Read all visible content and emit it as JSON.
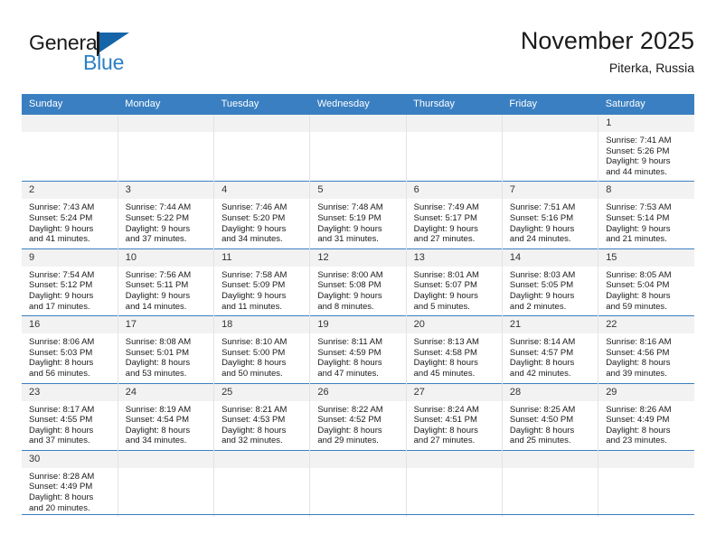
{
  "brand": {
    "name_top": "General",
    "name_bottom": "Blue",
    "color_dark": "#1a1a1a",
    "color_blue": "#2b7fc4",
    "flag_icon": "blue-flag-triangle"
  },
  "header": {
    "title": "November 2025",
    "subtitle": "Piterka, Russia"
  },
  "theme": {
    "header_bg": "#3a7fc1",
    "header_text": "#ffffff",
    "daynum_band_bg": "#f2f2f2",
    "row_divider": "#3a7fc1",
    "column_divider": "#e3e3e3"
  },
  "weekday_headers": [
    "Sunday",
    "Monday",
    "Tuesday",
    "Wednesday",
    "Thursday",
    "Friday",
    "Saturday"
  ],
  "weeks": [
    [
      {
        "blank": true,
        "day": ""
      },
      {
        "blank": true,
        "day": ""
      },
      {
        "blank": true,
        "day": ""
      },
      {
        "blank": true,
        "day": ""
      },
      {
        "blank": true,
        "day": ""
      },
      {
        "blank": true,
        "day": ""
      },
      {
        "blank": false,
        "day": "1",
        "sunrise": "Sunrise: 7:41 AM",
        "sunset": "Sunset: 5:26 PM",
        "daylight_line1": "Daylight: 9 hours",
        "daylight_line2": "and 44 minutes."
      }
    ],
    [
      {
        "blank": false,
        "day": "2",
        "sunrise": "Sunrise: 7:43 AM",
        "sunset": "Sunset: 5:24 PM",
        "daylight_line1": "Daylight: 9 hours",
        "daylight_line2": "and 41 minutes."
      },
      {
        "blank": false,
        "day": "3",
        "sunrise": "Sunrise: 7:44 AM",
        "sunset": "Sunset: 5:22 PM",
        "daylight_line1": "Daylight: 9 hours",
        "daylight_line2": "and 37 minutes."
      },
      {
        "blank": false,
        "day": "4",
        "sunrise": "Sunrise: 7:46 AM",
        "sunset": "Sunset: 5:20 PM",
        "daylight_line1": "Daylight: 9 hours",
        "daylight_line2": "and 34 minutes."
      },
      {
        "blank": false,
        "day": "5",
        "sunrise": "Sunrise: 7:48 AM",
        "sunset": "Sunset: 5:19 PM",
        "daylight_line1": "Daylight: 9 hours",
        "daylight_line2": "and 31 minutes."
      },
      {
        "blank": false,
        "day": "6",
        "sunrise": "Sunrise: 7:49 AM",
        "sunset": "Sunset: 5:17 PM",
        "daylight_line1": "Daylight: 9 hours",
        "daylight_line2": "and 27 minutes."
      },
      {
        "blank": false,
        "day": "7",
        "sunrise": "Sunrise: 7:51 AM",
        "sunset": "Sunset: 5:16 PM",
        "daylight_line1": "Daylight: 9 hours",
        "daylight_line2": "and 24 minutes."
      },
      {
        "blank": false,
        "day": "8",
        "sunrise": "Sunrise: 7:53 AM",
        "sunset": "Sunset: 5:14 PM",
        "daylight_line1": "Daylight: 9 hours",
        "daylight_line2": "and 21 minutes."
      }
    ],
    [
      {
        "blank": false,
        "day": "9",
        "sunrise": "Sunrise: 7:54 AM",
        "sunset": "Sunset: 5:12 PM",
        "daylight_line1": "Daylight: 9 hours",
        "daylight_line2": "and 17 minutes."
      },
      {
        "blank": false,
        "day": "10",
        "sunrise": "Sunrise: 7:56 AM",
        "sunset": "Sunset: 5:11 PM",
        "daylight_line1": "Daylight: 9 hours",
        "daylight_line2": "and 14 minutes."
      },
      {
        "blank": false,
        "day": "11",
        "sunrise": "Sunrise: 7:58 AM",
        "sunset": "Sunset: 5:09 PM",
        "daylight_line1": "Daylight: 9 hours",
        "daylight_line2": "and 11 minutes."
      },
      {
        "blank": false,
        "day": "12",
        "sunrise": "Sunrise: 8:00 AM",
        "sunset": "Sunset: 5:08 PM",
        "daylight_line1": "Daylight: 9 hours",
        "daylight_line2": "and 8 minutes."
      },
      {
        "blank": false,
        "day": "13",
        "sunrise": "Sunrise: 8:01 AM",
        "sunset": "Sunset: 5:07 PM",
        "daylight_line1": "Daylight: 9 hours",
        "daylight_line2": "and 5 minutes."
      },
      {
        "blank": false,
        "day": "14",
        "sunrise": "Sunrise: 8:03 AM",
        "sunset": "Sunset: 5:05 PM",
        "daylight_line1": "Daylight: 9 hours",
        "daylight_line2": "and 2 minutes."
      },
      {
        "blank": false,
        "day": "15",
        "sunrise": "Sunrise: 8:05 AM",
        "sunset": "Sunset: 5:04 PM",
        "daylight_line1": "Daylight: 8 hours",
        "daylight_line2": "and 59 minutes."
      }
    ],
    [
      {
        "blank": false,
        "day": "16",
        "sunrise": "Sunrise: 8:06 AM",
        "sunset": "Sunset: 5:03 PM",
        "daylight_line1": "Daylight: 8 hours",
        "daylight_line2": "and 56 minutes."
      },
      {
        "blank": false,
        "day": "17",
        "sunrise": "Sunrise: 8:08 AM",
        "sunset": "Sunset: 5:01 PM",
        "daylight_line1": "Daylight: 8 hours",
        "daylight_line2": "and 53 minutes."
      },
      {
        "blank": false,
        "day": "18",
        "sunrise": "Sunrise: 8:10 AM",
        "sunset": "Sunset: 5:00 PM",
        "daylight_line1": "Daylight: 8 hours",
        "daylight_line2": "and 50 minutes."
      },
      {
        "blank": false,
        "day": "19",
        "sunrise": "Sunrise: 8:11 AM",
        "sunset": "Sunset: 4:59 PM",
        "daylight_line1": "Daylight: 8 hours",
        "daylight_line2": "and 47 minutes."
      },
      {
        "blank": false,
        "day": "20",
        "sunrise": "Sunrise: 8:13 AM",
        "sunset": "Sunset: 4:58 PM",
        "daylight_line1": "Daylight: 8 hours",
        "daylight_line2": "and 45 minutes."
      },
      {
        "blank": false,
        "day": "21",
        "sunrise": "Sunrise: 8:14 AM",
        "sunset": "Sunset: 4:57 PM",
        "daylight_line1": "Daylight: 8 hours",
        "daylight_line2": "and 42 minutes."
      },
      {
        "blank": false,
        "day": "22",
        "sunrise": "Sunrise: 8:16 AM",
        "sunset": "Sunset: 4:56 PM",
        "daylight_line1": "Daylight: 8 hours",
        "daylight_line2": "and 39 minutes."
      }
    ],
    [
      {
        "blank": false,
        "day": "23",
        "sunrise": "Sunrise: 8:17 AM",
        "sunset": "Sunset: 4:55 PM",
        "daylight_line1": "Daylight: 8 hours",
        "daylight_line2": "and 37 minutes."
      },
      {
        "blank": false,
        "day": "24",
        "sunrise": "Sunrise: 8:19 AM",
        "sunset": "Sunset: 4:54 PM",
        "daylight_line1": "Daylight: 8 hours",
        "daylight_line2": "and 34 minutes."
      },
      {
        "blank": false,
        "day": "25",
        "sunrise": "Sunrise: 8:21 AM",
        "sunset": "Sunset: 4:53 PM",
        "daylight_line1": "Daylight: 8 hours",
        "daylight_line2": "and 32 minutes."
      },
      {
        "blank": false,
        "day": "26",
        "sunrise": "Sunrise: 8:22 AM",
        "sunset": "Sunset: 4:52 PM",
        "daylight_line1": "Daylight: 8 hours",
        "daylight_line2": "and 29 minutes."
      },
      {
        "blank": false,
        "day": "27",
        "sunrise": "Sunrise: 8:24 AM",
        "sunset": "Sunset: 4:51 PM",
        "daylight_line1": "Daylight: 8 hours",
        "daylight_line2": "and 27 minutes."
      },
      {
        "blank": false,
        "day": "28",
        "sunrise": "Sunrise: 8:25 AM",
        "sunset": "Sunset: 4:50 PM",
        "daylight_line1": "Daylight: 8 hours",
        "daylight_line2": "and 25 minutes."
      },
      {
        "blank": false,
        "day": "29",
        "sunrise": "Sunrise: 8:26 AM",
        "sunset": "Sunset: 4:49 PM",
        "daylight_line1": "Daylight: 8 hours",
        "daylight_line2": "and 23 minutes."
      }
    ],
    [
      {
        "blank": false,
        "day": "30",
        "sunrise": "Sunrise: 8:28 AM",
        "sunset": "Sunset: 4:49 PM",
        "daylight_line1": "Daylight: 8 hours",
        "daylight_line2": "and 20 minutes."
      },
      {
        "blank": true,
        "day": ""
      },
      {
        "blank": true,
        "day": ""
      },
      {
        "blank": true,
        "day": ""
      },
      {
        "blank": true,
        "day": ""
      },
      {
        "blank": true,
        "day": ""
      },
      {
        "blank": true,
        "day": ""
      }
    ]
  ]
}
